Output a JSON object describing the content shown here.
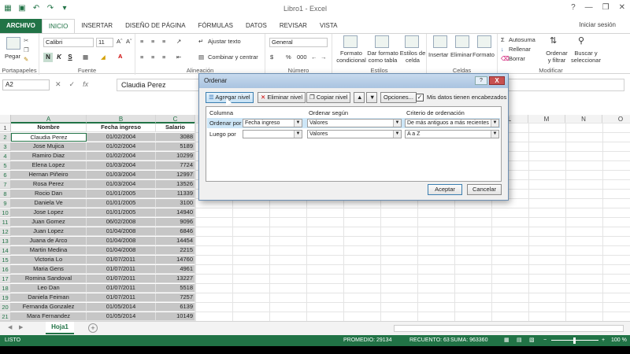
{
  "window": {
    "title": "Libro1 - Excel",
    "help": "?",
    "minimize": "—",
    "restore": "❐",
    "close": "✕"
  },
  "tabs": [
    "ARCHIVO",
    "INICIO",
    "INSERTAR",
    "DISEÑO DE PÁGINA",
    "FÓRMULAS",
    "DATOS",
    "REVISAR",
    "VISTA"
  ],
  "signin": "Iniciar sesión",
  "ribbon": {
    "clipboard": {
      "label": "Portapapeles",
      "paste": "Pegar"
    },
    "font": {
      "label": "Fuente",
      "name": "Calibri",
      "size": "11",
      "bold": "N",
      "italic": "K",
      "underline": "S"
    },
    "alignment": {
      "label": "Alineación",
      "wrap": "Ajustar texto",
      "merge": "Combinar y centrar"
    },
    "number": {
      "label": "Número",
      "format": "General",
      "currency": "$",
      "percent": "%",
      "thousands": "000"
    },
    "styles": {
      "label": "Estilos",
      "conditional": [
        "Formato",
        "condicional"
      ],
      "table": [
        "Dar formato",
        "como tabla"
      ],
      "cellstyles": [
        "Estilos de",
        "celda"
      ]
    },
    "cells": {
      "label": "Celdas",
      "insert": "Insertar",
      "delete": "Eliminar",
      "format": "Formato"
    },
    "editing": {
      "label": "Modificar",
      "autosum": "Autosuma",
      "fill": "Rellenar",
      "clear": "Borrar",
      "sort": [
        "Ordenar",
        "y filtrar"
      ],
      "find": [
        "Buscar y",
        "seleccionar"
      ]
    }
  },
  "formula_bar": {
    "namebox": "A2",
    "value": "Claudia Perez"
  },
  "columns": [
    "A",
    "B",
    "C",
    "D",
    "E",
    "F",
    "G",
    "H",
    "I",
    "J",
    "K",
    "L",
    "M",
    "N",
    "O"
  ],
  "headers": [
    "Nombre",
    "Fecha ingreso",
    "Salario"
  ],
  "rows": [
    [
      "Claudia Perez",
      "01/02/2004",
      "3088"
    ],
    [
      "Jose Mujica",
      "01/02/2004",
      "5189"
    ],
    [
      "Ramiro Diaz",
      "01/02/2004",
      "10299"
    ],
    [
      "Elena Lopez",
      "01/03/2004",
      "7724"
    ],
    [
      "Hernan Piñeiro",
      "01/03/2004",
      "12997"
    ],
    [
      "Rosa Perez",
      "01/03/2004",
      "13526"
    ],
    [
      "Rocio Dan",
      "01/01/2005",
      "11339"
    ],
    [
      "Daniela Ve",
      "01/01/2005",
      "3100"
    ],
    [
      "Jose Lopez",
      "01/01/2005",
      "14940"
    ],
    [
      "Juan Gomez",
      "06/02/2008",
      "9096"
    ],
    [
      "Juan Lopez",
      "01/04/2008",
      "6846"
    ],
    [
      "Juana de Arco",
      "01/04/2008",
      "14454"
    ],
    [
      "Martin Medina",
      "01/04/2008",
      "2215"
    ],
    [
      "Victoria Lo",
      "01/07/2011",
      "14760"
    ],
    [
      "Maria Gens",
      "01/07/2011",
      "4961"
    ],
    [
      "Romina Sandoval",
      "01/07/2011",
      "13227"
    ],
    [
      "Leo Dan",
      "01/07/2011",
      "5518"
    ],
    [
      "Daniela Feiman",
      "01/07/2011",
      "7257"
    ],
    [
      "Fernanda Gonzalez",
      "01/05/2014",
      "6139"
    ],
    [
      "Mara Fernandez",
      "01/05/2014",
      "10149"
    ]
  ],
  "row_numbers": [
    "1",
    "2",
    "3",
    "4",
    "5",
    "6",
    "7",
    "8",
    "9",
    "10",
    "11",
    "12",
    "13",
    "14",
    "15",
    "16",
    "17",
    "18",
    "19",
    "20",
    "21"
  ],
  "sheet": {
    "tab": "Hoja1",
    "add": "+"
  },
  "status": {
    "ready": "LISTO",
    "average": "PROMEDIO: 29134",
    "count": "RECUENTO: 63",
    "sum": "SUMA: 963360",
    "zoom": "100 %"
  },
  "dialog": {
    "title": "Ordenar",
    "help": "?",
    "close": "X",
    "add_level": "Agregar nivel",
    "delete_level": "Eliminar nivel",
    "copy_level": "Copiar nivel",
    "options": "Opciones...",
    "has_headers_label": "Mis datos tienen encabezados",
    "has_headers_checked": "✓",
    "col_header": "Columna",
    "sort_on_header": "Ordenar según",
    "order_header": "Criterio de ordenación",
    "levels": [
      {
        "label": "Ordenar por",
        "column": "Fecha ingreso",
        "sort_on": "Valores",
        "order": "De más antiguos a más recientes"
      },
      {
        "label": "Luego por",
        "column": "",
        "sort_on": "Valores",
        "order": "A a Z"
      }
    ],
    "ok": "Aceptar",
    "cancel": "Cancelar"
  },
  "colors": {
    "accent": "#217346",
    "selection": "#c6c6c6"
  }
}
